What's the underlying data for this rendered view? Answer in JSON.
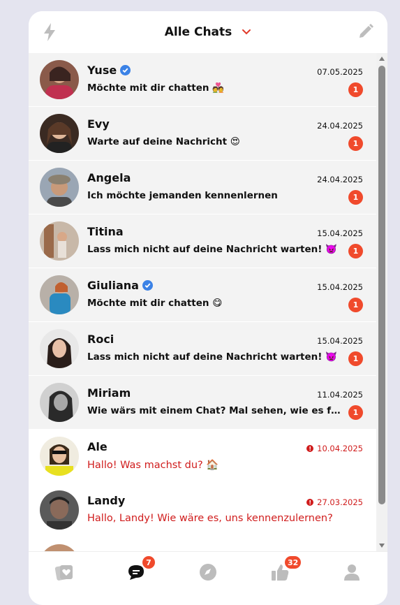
{
  "header": {
    "title": "Alle Chats",
    "left_icon": "bolt-icon",
    "right_icon": "pencil-icon",
    "accent": "#e03a2a"
  },
  "chats": [
    {
      "name": "Yuse",
      "verified": true,
      "message": "Möchte mit dir chatten 💑",
      "date": "07.05.2025",
      "unread": "1",
      "read": false
    },
    {
      "name": "Evy",
      "verified": false,
      "message": "Warte auf deine Nachricht 😍",
      "date": "24.04.2025",
      "unread": "1",
      "read": false
    },
    {
      "name": "Angela",
      "verified": false,
      "message": "Ich möchte jemanden kennenlernen",
      "date": "24.04.2025",
      "unread": "1",
      "read": false
    },
    {
      "name": "Titina",
      "verified": false,
      "message": "Lass mich nicht auf deine Nachricht warten! 👿",
      "date": "15.04.2025",
      "unread": "1",
      "read": false
    },
    {
      "name": "Giuliana",
      "verified": true,
      "message": "Möchte mit dir chatten 😋",
      "date": "15.04.2025",
      "unread": "1",
      "read": false
    },
    {
      "name": "Roci",
      "verified": false,
      "message": "Lass mich nicht auf deine Nachricht warten! 👿",
      "date": "15.04.2025",
      "unread": "1",
      "read": false
    },
    {
      "name": "Miriam",
      "verified": false,
      "message": "Wie wärs mit einem Chat? Mal sehen, wie es funkt...",
      "date": "11.04.2025",
      "unread": "1",
      "read": false
    },
    {
      "name": "Ale",
      "verified": false,
      "message": "Hallo! Was machst du? 🏠",
      "date": "10.04.2025",
      "unread": "",
      "read": true
    },
    {
      "name": "Landy",
      "verified": false,
      "message": "Hallo, Landy! Wie wäre es, uns kennenzulernen?",
      "date": "27.03.2025",
      "unread": "",
      "read": true
    }
  ],
  "nav": {
    "items": [
      "cards-icon",
      "chat-icon",
      "compass-icon",
      "thumbs-up-icon",
      "profile-icon"
    ],
    "chat_badge": "7",
    "likes_badge": "32",
    "badge_color": "#f04a2c"
  },
  "colors": {
    "unread_row": "#f3f3f3",
    "read_text": "#d01c1c",
    "badge": "#f04a2c"
  }
}
